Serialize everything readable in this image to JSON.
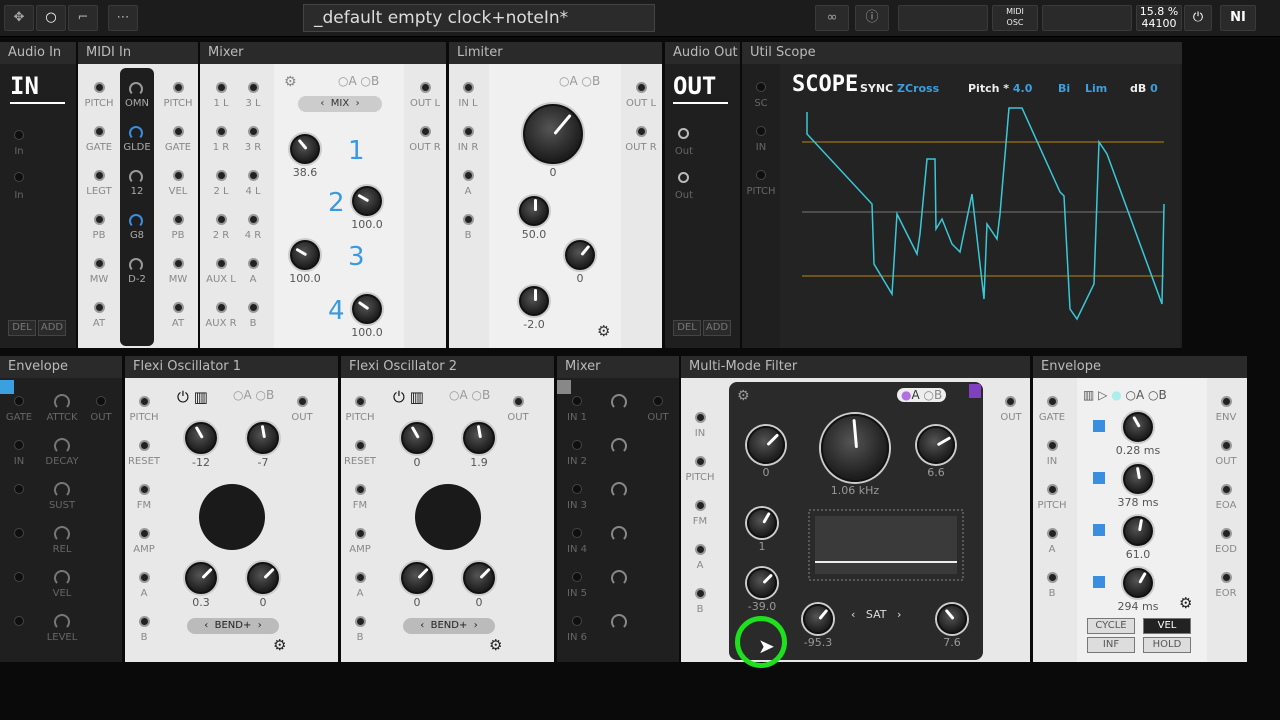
{
  "topbar": {
    "title": "_default empty clock+noteIn*",
    "cpu": "15.8 %",
    "rate": "44100",
    "midi1": "MIDI",
    "midi2": "OSC"
  },
  "headers": {
    "audio_in": "Audio In",
    "midi_in": "MIDI In",
    "mixer": "Mixer",
    "limiter": "Limiter",
    "audio_out": "Audio Out",
    "util_scope": "Util Scope",
    "envelope": "Envelope",
    "flexi1": "Flexi Oscillator 1",
    "flexi2": "Flexi Oscillator 2",
    "mixer2": "Mixer",
    "mmf": "Multi-Mode Filter",
    "envelope2": "Envelope"
  },
  "audio_in": {
    "big": "IN",
    "p1": "In",
    "p2": "In",
    "del": "DEL",
    "add": "ADD"
  },
  "midi_in": {
    "left": [
      "PITCH",
      "GATE",
      "LEGT",
      "PB",
      "MW",
      "AT"
    ],
    "mid": [
      "OMN",
      "GLDE",
      "12",
      "G8",
      "D-2"
    ],
    "right": [
      "PITCH",
      "GATE",
      "VEL",
      "PB",
      "MW",
      "AT"
    ]
  },
  "mixer": {
    "left": [
      "1 L",
      "1 R",
      "2 L",
      "2 R",
      "AUX L",
      "AUX R"
    ],
    "left2": [
      "3 L",
      "3 R",
      "4 L",
      "4 R",
      "A",
      "B"
    ],
    "ab_a": "A",
    "ab_b": "B",
    "mix": "MIX",
    "nums": [
      "1",
      "2",
      "3",
      "4"
    ],
    "vals": [
      "38.6",
      "100.0",
      "100.0",
      "100.0"
    ],
    "outs": [
      "OUT L",
      "OUT R"
    ]
  },
  "limiter": {
    "ins": [
      "IN L",
      "IN R",
      "A",
      "B"
    ],
    "ab_a": "A",
    "ab_b": "B",
    "vals": [
      "0",
      "50.0",
      "0",
      "-2.0"
    ],
    "outs": [
      "OUT L",
      "OUT R"
    ]
  },
  "audio_out": {
    "big": "OUT",
    "p1": "Out",
    "p2": "Out",
    "del": "DEL",
    "add": "ADD"
  },
  "scope": {
    "ports": [
      "SC",
      "IN",
      "PITCH"
    ],
    "big": "SCOPE",
    "sync": "SYNC",
    "zcross": "ZCross",
    "pitch": "Pitch *",
    "pitch_val": "4.0",
    "bi": "Bi",
    "lim": "Lim",
    "db": "dB",
    "db_val": "0"
  },
  "envelope": {
    "left": [
      "GATE",
      "IN",
      "",
      "",
      "",
      ""
    ],
    "mid": [
      "ATTCK",
      "DECAY",
      "SUST",
      "REL",
      "VEL",
      "LEVEL"
    ],
    "right": [
      "OUT"
    ]
  },
  "flexi1": {
    "ports": [
      "PITCH",
      "RESET",
      "FM",
      "AMP",
      "A",
      "B"
    ],
    "out": "OUT",
    "vals": [
      "-12",
      "-7",
      "0.3",
      "0"
    ],
    "bend": "BEND+",
    "ab_a": "A",
    "ab_b": "B"
  },
  "flexi2": {
    "ports": [
      "PITCH",
      "RESET",
      "FM",
      "AMP",
      "A",
      "B"
    ],
    "out": "OUT",
    "vals": [
      "0",
      "1.9",
      "0",
      "0"
    ],
    "bend": "BEND+",
    "ab_a": "A",
    "ab_b": "B"
  },
  "mixer2": {
    "ins": [
      "IN 1",
      "IN 2",
      "IN 3",
      "IN 4",
      "IN 5",
      "IN 6"
    ],
    "out": "OUT"
  },
  "mmf": {
    "ports": [
      "IN",
      "PITCH",
      "FM",
      "A",
      "B"
    ],
    "out": "OUT",
    "ab_a": "A",
    "ab_b": "B",
    "vals": [
      "0",
      "1.06 kHz",
      "6.6",
      "1",
      "-39.0",
      "-95.3",
      "7.6"
    ],
    "sat": "SAT"
  },
  "envelope2": {
    "ports": [
      "GATE",
      "IN",
      "PITCH",
      "A",
      "B"
    ],
    "outs": [
      "ENV",
      "OUT",
      "EOA",
      "EOD",
      "EOR"
    ],
    "ab_a": "A",
    "ab_b": "B",
    "vals": [
      "0.28 ms",
      "378 ms",
      "61.0",
      "294 ms"
    ],
    "cycle": "CYCLE",
    "vel": "VEL",
    "inf": "INF",
    "hold": "HOLD"
  }
}
